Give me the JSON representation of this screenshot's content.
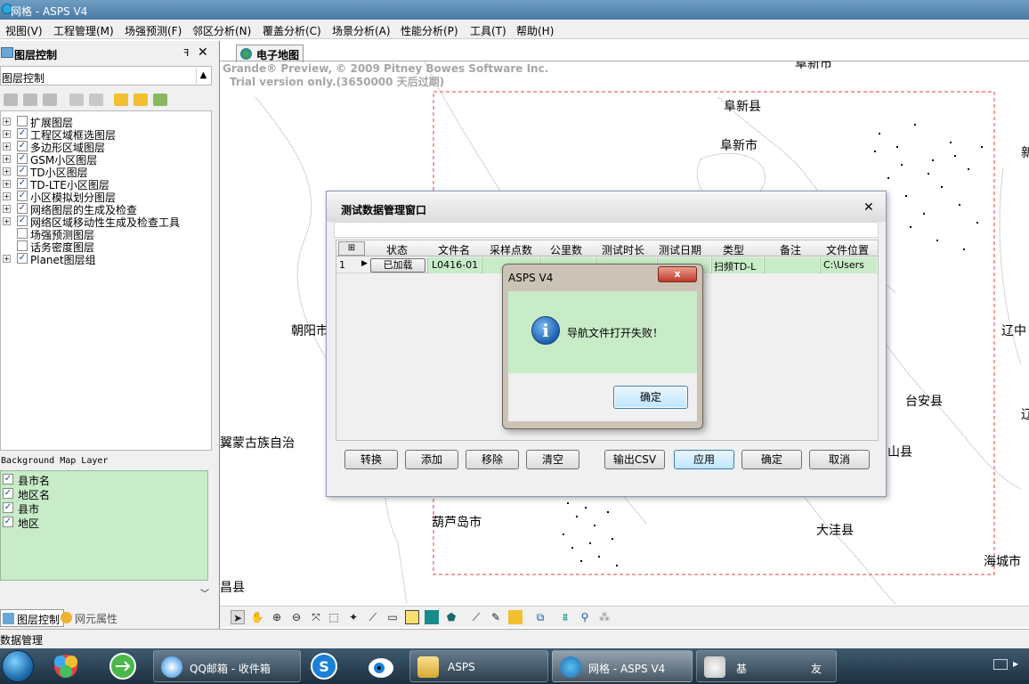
{
  "window": {
    "title": "网格 - ASPS V4"
  },
  "menu": [
    "视图(V)",
    "工程管理(M)",
    "场强预测(F)",
    "邻区分析(N)",
    "覆盖分析(C)",
    "场景分析(A)",
    "性能分析(P)",
    "工具(T)",
    "帮助(H)"
  ],
  "left_panel": {
    "header": "图层控制",
    "pin_glyph": "ꟻ",
    "close_glyph": "✕",
    "combo_value": "图层控制",
    "tree": [
      {
        "label": "扩展图层",
        "checked": false,
        "expandable": true
      },
      {
        "label": "工程区域框选图层",
        "checked": true,
        "expandable": true
      },
      {
        "label": "多边形区域图层",
        "checked": true,
        "expandable": true
      },
      {
        "label": "GSM小区图层",
        "checked": true,
        "expandable": true
      },
      {
        "label": "TD小区图层",
        "checked": true,
        "expandable": true
      },
      {
        "label": "TD-LTE小区图层",
        "checked": true,
        "expandable": true
      },
      {
        "label": "小区模拟划分图层",
        "checked": true,
        "expandable": true
      },
      {
        "label": "网络图层的生成及检查",
        "checked": true,
        "expandable": true
      },
      {
        "label": "网络区域移动性生成及检查工具",
        "checked": true,
        "expandable": true
      },
      {
        "label": "场强预测图层",
        "checked": false,
        "expandable": false
      },
      {
        "label": "话务密度图层",
        "checked": false,
        "expandable": false
      },
      {
        "label": "Planet图层组",
        "checked": true,
        "expandable": true
      }
    ],
    "bg_header": "Background Map Layer",
    "bg_layers": [
      {
        "label": "县市名",
        "checked": true
      },
      {
        "label": "地区名",
        "checked": true
      },
      {
        "label": "县市",
        "checked": true
      },
      {
        "label": "地区",
        "checked": true
      }
    ],
    "tabs": [
      "图层控制",
      "网元属性"
    ]
  },
  "map": {
    "tab_label": "电子地图",
    "watermark_line1": "Grande® Preview, © 2009 Pitney Bowes Software Inc.",
    "watermark_line2": "Trial version only.(3650000 天后过期)",
    "labels": [
      "阜新县",
      "阜新市",
      "朝阳市",
      "翼蒙古族自治",
      "葫芦岛市",
      "台安县",
      "山县",
      "大洼县",
      "海城市",
      "辽中",
      "新",
      "辽",
      "昌县",
      "阜新市"
    ]
  },
  "test_dialog": {
    "title": "测试数据管理窗口",
    "close_glyph": "✕",
    "columns": [
      "状态",
      "文件名",
      "采样点数",
      "公里数",
      "测试时长",
      "测试日期",
      "类型",
      "备注",
      "文件位置"
    ],
    "row": {
      "index": "1",
      "status": "已加载",
      "file_name": "L0416-01",
      "samples": "",
      "km": "",
      "duration": "",
      "date": "",
      "type": "扫频TD-L",
      "note": "",
      "location": "C:\\Users"
    },
    "buttons": [
      "转换",
      "添加",
      "移除",
      "清空",
      "输出CSV",
      "应用",
      "确定",
      "取消"
    ]
  },
  "message_box": {
    "title": "ASPS V4",
    "close_glyph": "x",
    "text": "导航文件打开失败！",
    "ok_label": "确定"
  },
  "status_bar": {
    "text": "数据管理"
  },
  "taskbar": {
    "tasks": [
      {
        "label": "QQ邮箱 - 收件箱",
        "active": false
      },
      {
        "label": "ASPS",
        "active": false
      },
      {
        "label": "网格 - ASPS V4",
        "active": true
      },
      {
        "label": "基",
        "extra": "友",
        "active": false
      }
    ]
  },
  "colors": {
    "panel_green": "#c8ecc8",
    "title_blue": "#4a7ba6",
    "frame_red": "#e04040"
  }
}
